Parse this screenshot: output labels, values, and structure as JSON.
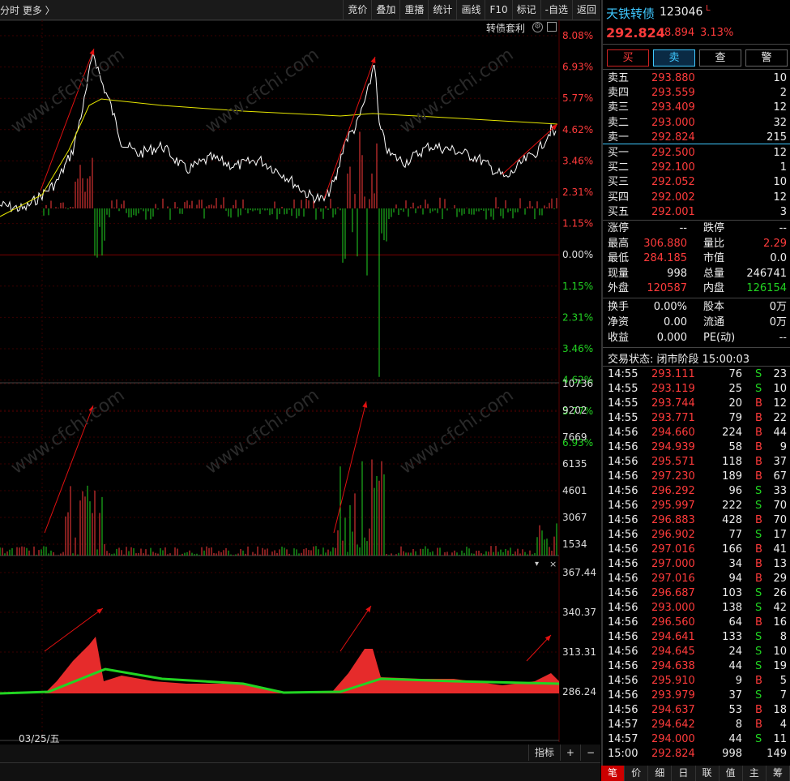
{
  "toolbar": {
    "left_text": "分时  更多 〉",
    "buttons": [
      "竞价",
      "叠加",
      "重播",
      "统计",
      "画线",
      "F10",
      "标记",
      "-自选",
      "返回"
    ]
  },
  "chart": {
    "overlay_label": "转债套利",
    "price_axis": [
      "8.08%",
      "6.93%",
      "5.77%",
      "4.62%",
      "3.46%",
      "2.31%",
      "1.15%",
      "0.00%",
      "1.15%",
      "2.31%",
      "3.46%",
      "4.62%",
      "5.77%",
      "6.93%"
    ],
    "volume_axis": [
      "10736",
      "9202",
      "7669",
      "6135",
      "4601",
      "3067",
      "1534"
    ],
    "indicator_axis": [
      "367.44",
      "340.37",
      "313.31",
      "286.24"
    ],
    "date_label": "03/25/五",
    "watermark": "www.cfchi.com",
    "bottom_buttons": [
      "指标",
      "+",
      "−"
    ],
    "colors": {
      "up": "#ff3b3b",
      "down": "#22d422",
      "price": "#ffffff",
      "avg": "#e6e600",
      "grid": "#3a0000"
    }
  },
  "quote": {
    "name": "天铁转债",
    "code": "123046",
    "flag": "L",
    "price": "292.824",
    "change": "8.894",
    "change_pct": "3.13%",
    "buttons": [
      "买",
      "卖",
      "查",
      "警"
    ],
    "asks": [
      {
        "label": "卖五",
        "price": "293.880",
        "vol": "10"
      },
      {
        "label": "卖四",
        "price": "293.559",
        "vol": "2"
      },
      {
        "label": "卖三",
        "price": "293.409",
        "vol": "12"
      },
      {
        "label": "卖二",
        "price": "293.000",
        "vol": "32"
      },
      {
        "label": "卖一",
        "price": "292.824",
        "vol": "215"
      }
    ],
    "bids": [
      {
        "label": "买一",
        "price": "292.500",
        "vol": "12"
      },
      {
        "label": "买二",
        "price": "292.100",
        "vol": "1"
      },
      {
        "label": "买三",
        "price": "292.052",
        "vol": "10"
      },
      {
        "label": "买四",
        "price": "292.002",
        "vol": "12"
      },
      {
        "label": "买五",
        "price": "292.001",
        "vol": "3"
      }
    ],
    "stats": [
      {
        "l1": "涨停",
        "v1": "--",
        "c1": "white",
        "l2": "跌停",
        "v2": "--",
        "c2": "white"
      },
      {
        "l1": "最高",
        "v1": "306.880",
        "c1": "red",
        "l2": "量比",
        "v2": "2.29",
        "c2": "red"
      },
      {
        "l1": "最低",
        "v1": "284.185",
        "c1": "red",
        "l2": "市值",
        "v2": "0.0",
        "c2": "white"
      },
      {
        "l1": "现量",
        "v1": "998",
        "c1": "white",
        "l2": "总量",
        "v2": "246741",
        "c2": "white"
      },
      {
        "l1": "外盘",
        "v1": "120587",
        "c1": "red",
        "l2": "内盘",
        "v2": "126154",
        "c2": "green"
      }
    ],
    "stats2": [
      {
        "l1": "换手",
        "v1": "0.00%",
        "l2": "股本",
        "v2": "0万"
      },
      {
        "l1": "净资",
        "v1": "0.00",
        "l2": "流通",
        "v2": "0万"
      },
      {
        "l1": "收益",
        "v1": "0.000",
        "l2": "PE(动)",
        "v2": "--"
      }
    ],
    "status": "交易状态: 闭市阶段 15:00:03",
    "ticks": [
      [
        "14:55",
        "293.111",
        "76",
        "S",
        "23"
      ],
      [
        "14:55",
        "293.119",
        "25",
        "S",
        "10"
      ],
      [
        "14:55",
        "293.744",
        "20",
        "B",
        "12"
      ],
      [
        "14:55",
        "293.771",
        "79",
        "B",
        "22"
      ],
      [
        "14:56",
        "294.660",
        "224",
        "B",
        "44"
      ],
      [
        "14:56",
        "294.939",
        "58",
        "B",
        "9"
      ],
      [
        "14:56",
        "295.571",
        "118",
        "B",
        "37"
      ],
      [
        "14:56",
        "297.230",
        "189",
        "B",
        "67"
      ],
      [
        "14:56",
        "296.292",
        "96",
        "S",
        "33"
      ],
      [
        "14:56",
        "295.997",
        "222",
        "S",
        "70"
      ],
      [
        "14:56",
        "296.883",
        "428",
        "B",
        "70"
      ],
      [
        "14:56",
        "296.902",
        "77",
        "S",
        "17"
      ],
      [
        "14:56",
        "297.016",
        "166",
        "B",
        "41"
      ],
      [
        "14:56",
        "297.000",
        "34",
        "B",
        "13"
      ],
      [
        "14:56",
        "297.016",
        "94",
        "B",
        "29"
      ],
      [
        "14:56",
        "296.687",
        "103",
        "S",
        "26"
      ],
      [
        "14:56",
        "293.000",
        "138",
        "S",
        "42"
      ],
      [
        "14:56",
        "296.560",
        "64",
        "B",
        "16"
      ],
      [
        "14:56",
        "294.641",
        "133",
        "S",
        "8"
      ],
      [
        "14:56",
        "294.645",
        "24",
        "S",
        "10"
      ],
      [
        "14:56",
        "294.638",
        "44",
        "S",
        "19"
      ],
      [
        "14:56",
        "295.910",
        "9",
        "B",
        "5"
      ],
      [
        "14:56",
        "293.979",
        "37",
        "S",
        "7"
      ],
      [
        "14:56",
        "294.637",
        "53",
        "B",
        "18"
      ],
      [
        "14:57",
        "294.642",
        "8",
        "B",
        "4"
      ],
      [
        "14:57",
        "294.000",
        "44",
        "S",
        "11"
      ],
      [
        "15:00",
        "292.824",
        "998",
        "",
        "149"
      ]
    ],
    "tabs": [
      "笔",
      "价",
      "细",
      "日",
      "联",
      "值",
      "主",
      "筹"
    ]
  }
}
